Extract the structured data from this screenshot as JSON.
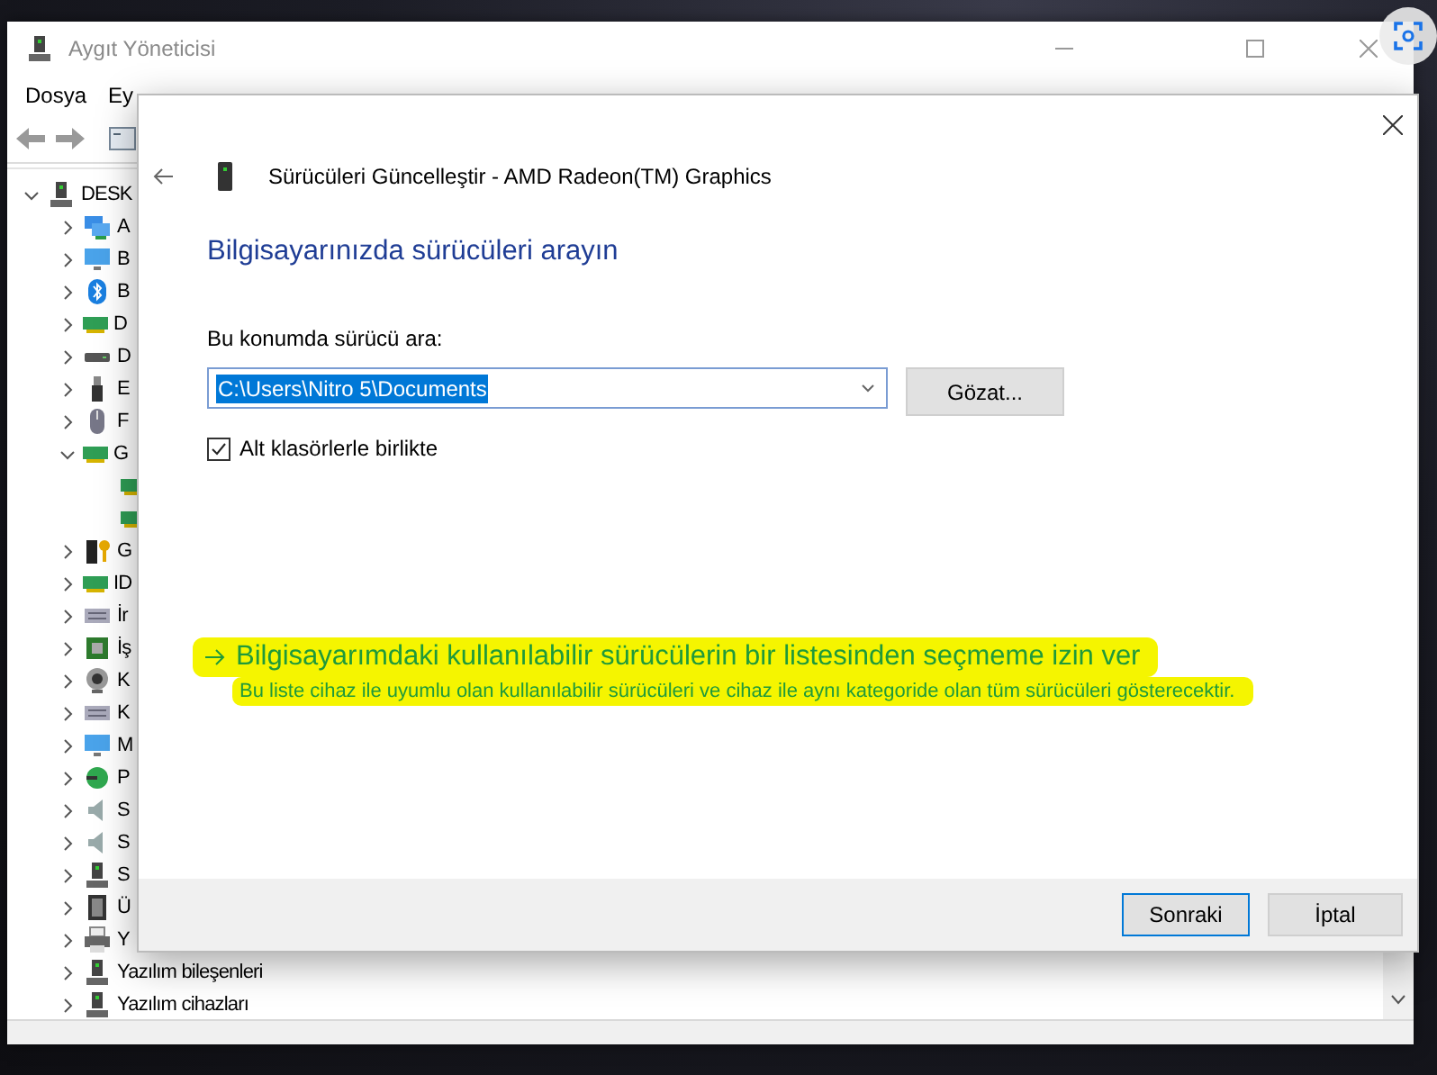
{
  "window": {
    "title": "Aygıt Yöneticisi",
    "active": false
  },
  "menu": [
    {
      "label": "Dosya"
    },
    {
      "label": "Ey"
    }
  ],
  "tree": {
    "label": "DESK",
    "kind": "group",
    "expanded": true,
    "children": [
      {
        "label": "A",
        "kind": "group",
        "expanded": false
      },
      {
        "label": "B",
        "kind": "group",
        "expanded": false
      },
      {
        "label": "B",
        "kind": "group",
        "expanded": false
      },
      {
        "label": "D",
        "kind": "group",
        "expanded": false
      },
      {
        "label": "D",
        "kind": "group",
        "expanded": false
      },
      {
        "label": "E",
        "kind": "group",
        "expanded": false
      },
      {
        "label": "F",
        "kind": "group",
        "expanded": false
      },
      {
        "label": "G",
        "kind": "group",
        "expanded": true,
        "children": [
          {
            "kind": "leaf"
          },
          {
            "kind": "leaf"
          }
        ]
      },
      {
        "label": "G",
        "kind": "group",
        "expanded": false
      },
      {
        "label": "ID",
        "kind": "group",
        "expanded": false
      },
      {
        "label": "İr",
        "kind": "group",
        "expanded": false
      },
      {
        "label": "İş",
        "kind": "group",
        "expanded": false
      },
      {
        "label": "K",
        "kind": "group",
        "expanded": false
      },
      {
        "label": "K",
        "kind": "group",
        "expanded": false
      },
      {
        "label": "M",
        "kind": "group",
        "expanded": false
      },
      {
        "label": "P",
        "kind": "group",
        "expanded": false
      },
      {
        "label": "S",
        "kind": "group",
        "expanded": false
      },
      {
        "label": "S",
        "kind": "group",
        "expanded": false
      },
      {
        "label": "S",
        "kind": "group",
        "expanded": false
      },
      {
        "label": "Ü",
        "kind": "group",
        "expanded": false
      },
      {
        "label": "Y",
        "kind": "group",
        "expanded": false
      },
      {
        "label": "Yazılım bileşenleri",
        "kind": "group",
        "expanded": false
      },
      {
        "label": "Yazılım cihazları",
        "kind": "group",
        "expanded": false
      }
    ]
  },
  "dialog": {
    "title": "Sürücüleri Güncelleştir - AMD Radeon(TM) Graphics",
    "heading": "Bilgisayarınızda sürücüleri arayın",
    "location_label": "Bu konumda sürücü ara:",
    "location": {
      "value": "C:\\Users\\Nitro 5\\Documents",
      "selected": true
    },
    "browse_button": "Gözat...",
    "include_subfolders": {
      "label": "Alt klasörlerle birlikte",
      "checked": true
    },
    "pick_link": {
      "label": "Bilgisayarımdaki kullanılabilir sürücülerin bir listesinden seçmeme izin ver",
      "description": "Bu liste cihaz ile uyumlu olan kullanılabilir sürücüleri ve cihaz ile aynı kategoride olan tüm sürücüleri gösterecektir.",
      "highlighted": true
    },
    "buttons": [
      {
        "label": "Sonraki",
        "default": true
      },
      {
        "label": "İptal",
        "default": false
      }
    ]
  }
}
